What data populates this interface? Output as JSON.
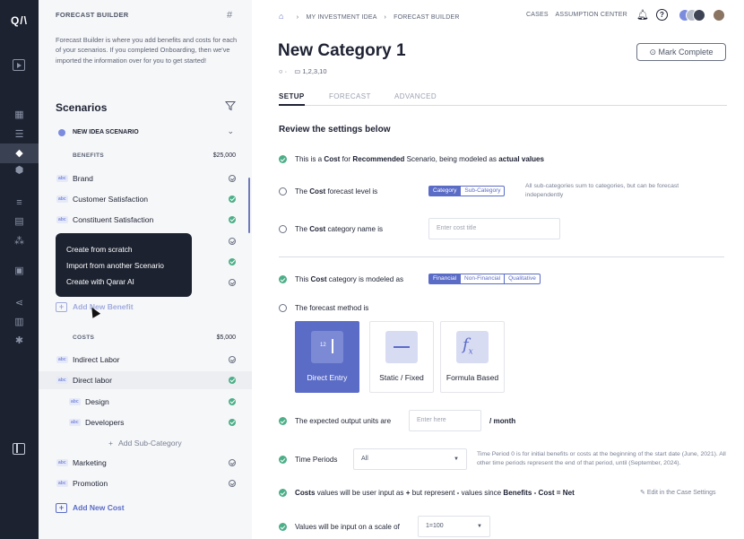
{
  "rail": {
    "logo": "Q/\\",
    "icons": [
      "play-icon",
      "grid-icon",
      "list-icon",
      "forecast-icon",
      "box-icon",
      "sliders-icon",
      "report-icon",
      "nodes-icon",
      "calc-icon",
      "share-icon",
      "chart-icon",
      "settings-icon",
      "panel-icon"
    ]
  },
  "sidebar": {
    "title": "FORECAST BUILDER",
    "description": "Forecast Builder is where you add benefits and costs for each of your scenarios. If you completed Onboarding, then we've imported the information over for you to get started!",
    "scenarios_heading": "Scenarios",
    "scenario_name": "NEW IDEA SCENARIO",
    "benefits_label": "BENEFITS",
    "benefits_amount": "$25,000",
    "benefits": [
      {
        "label": "Brand",
        "status": "pending"
      },
      {
        "label": "Customer Satisfaction",
        "status": "complete"
      },
      {
        "label": "Constituent Satisfaction",
        "status": "complete"
      },
      {
        "label": "",
        "status": "pending"
      },
      {
        "label": "",
        "status": "complete"
      },
      {
        "label": "",
        "status": "pending"
      }
    ],
    "abc_tag": "abc",
    "add_benefit": "Add New Benefit",
    "costs_label": "COSTS",
    "costs_amount": "$5,000",
    "costs": [
      {
        "label": "Indirect Labor",
        "status": "pending"
      },
      {
        "label": "Direct labor",
        "status": "complete"
      }
    ],
    "sub_categories": [
      {
        "label": "Design",
        "status": "complete"
      },
      {
        "label": "Developers",
        "status": "complete"
      }
    ],
    "add_sub": "Add Sub-Category",
    "costs_more": [
      {
        "label": "Marketing",
        "status": "pending"
      },
      {
        "label": "Promotion",
        "status": "pending"
      }
    ],
    "add_cost": "Add New Cost",
    "popup": [
      "Create from scratch",
      "Import from another Scenario",
      "Create with Qarar AI"
    ]
  },
  "header": {
    "breadcrumb": [
      "MY INVESTMENT IDEA",
      "FORECAST BUILDER"
    ],
    "links": [
      "CASES",
      "ASSUMPTION CENTER"
    ],
    "avatar_colors": [
      "#7b8cdf",
      "#b7bcc9",
      "#3d4352"
    ],
    "help": "?"
  },
  "page": {
    "title": "New Category 1",
    "meta_sep": "·",
    "meta_periods": "1,2,3,10",
    "mark_complete": "Mark Complete",
    "tabs": [
      "SETUP",
      "FORECAST",
      "ADVANCED"
    ],
    "section_heading": "Review the settings below",
    "cost_line": {
      "p1": "This is a ",
      "b1": "Cost",
      "p2": " for ",
      "b2": "Recommended",
      "p3": " Scenario, being modeled as ",
      "b3": "actual values"
    },
    "level_line": {
      "p1": "The ",
      "b1": "Cost",
      "p2": " forecast level is"
    },
    "level_options": [
      "Category",
      "Sub-Category"
    ],
    "level_hint": "All sub-categories  sum to categories, but can be forecast independently",
    "name_line": {
      "p1": "The ",
      "b1": "Cost",
      "p2": " category name is"
    },
    "name_placeholder": "Enter cost title",
    "model_line": {
      "p1": "This ",
      "b1": "Cost",
      "p2": " category is modeled as"
    },
    "model_options": [
      "Financial",
      "Non-Financial",
      "Qualitative"
    ],
    "method_line": "The forecast method is",
    "methods": [
      "Direct Entry",
      "Static / Fixed",
      "Formula Based"
    ],
    "method_icon_text": "12",
    "units_line": "The expected output units are",
    "units_placeholder": "Enter here",
    "units_suffix": "/ month",
    "periods_line": "Time Periods",
    "periods_value": "All",
    "periods_hint": "Time Period 0 is for initial benefits or costs at the beginning of the start date (June, 2021). All other time periods represent the end of that period, until (September, 2024).",
    "values_line": {
      "b1": "Costs",
      "p1": " values will be user input as ",
      "b2": "+",
      "p2": " but represent ",
      "b3": "-",
      "p3": " values since ",
      "b4": "Benefits - Cost = Net"
    },
    "edit_link": "Edit in the Case Settings",
    "scale_line": "Values will be input on a scale of",
    "scale_value": "1=100"
  },
  "colors": {
    "accent": "#5b6cc7",
    "success": "#4caf88",
    "rail": "#1c2230"
  }
}
